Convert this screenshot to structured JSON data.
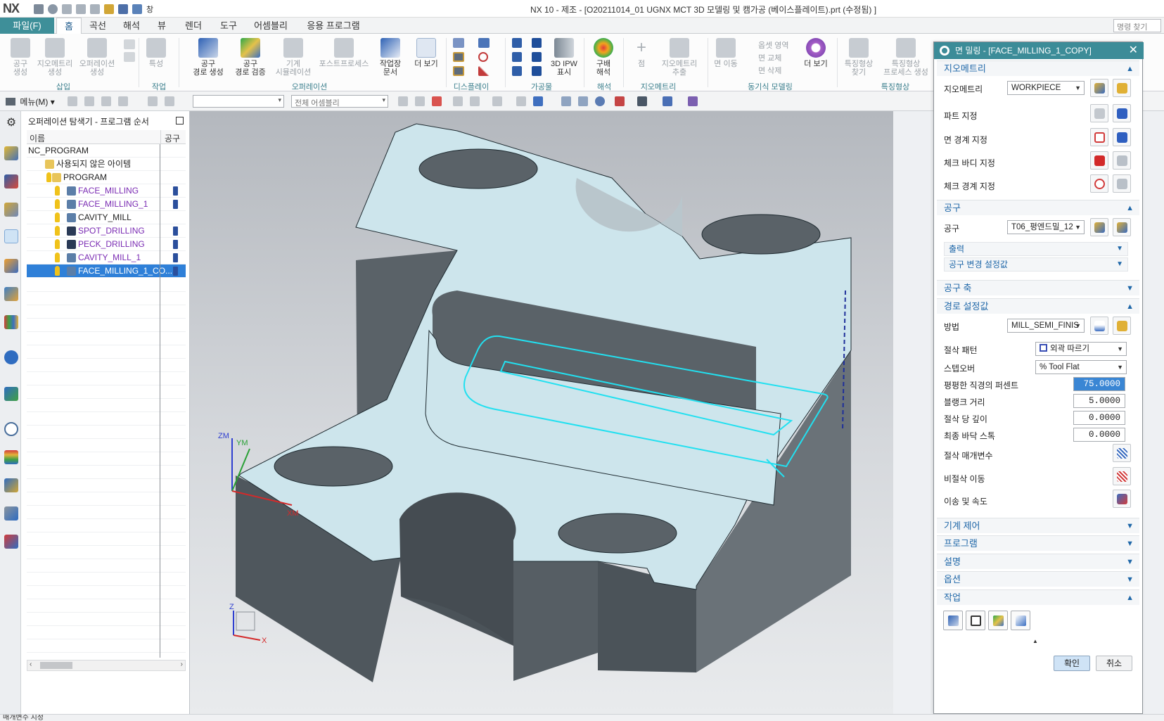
{
  "app": {
    "logo": "NX",
    "title": "NX 10 - 제조 - [O20211014_01 UGNX MCT 3D 모델링 및 캠가공 (베이스플레이트).prt (수정됨) ]",
    "qat_window_label": "창"
  },
  "menubar": {
    "file_tab": "파일(F)",
    "tabs": [
      "홈",
      "곡선",
      "해석",
      "뷰",
      "렌더",
      "도구",
      "어셈블리",
      "응용 프로그램"
    ],
    "command_search_placeholder": "명령 찾기"
  },
  "ribbon": {
    "buttons": {
      "tool_create": "공구\n생성",
      "geometry_create": "지오메트리\n생성",
      "operation_create": "오퍼레이션\n생성",
      "feature": "특성",
      "toolpath_create": "공구\n경로 생성",
      "toolpath_verify": "공구\n경로 검증",
      "machine_sim": "기계\n시뮬레이션",
      "postprocess": "포스트프로세스",
      "shop_doc": "작업장\n문서",
      "more_view": "더 보기",
      "ipw_3d": "3D IPW\n표시",
      "gradient": "구배\n해석",
      "point": "점",
      "geom_extract": "지오메트리\n추출",
      "face_move": "면 이동",
      "more_view2": "더 보기",
      "feature_find": "특징형상\n찾기",
      "feature_process": "특징형상\n프로세스 생성",
      "offset_region": "옵셋 영역",
      "face_replace": "면 교체",
      "face_delete": "면 삭제"
    },
    "groups": {
      "insert": "삽입",
      "work": "작업",
      "operation": "오퍼레이션",
      "display": "디스플레이",
      "workpiece": "가공물",
      "analysis": "해석",
      "geometry": "지오메트리",
      "sync_modeling": "동기식 모델링",
      "features": "특징형상"
    }
  },
  "toolbar2": {
    "menu": "메뉴(M)",
    "filter_combo": "",
    "assembly_combo": "전체 어셈블리"
  },
  "navigator": {
    "title": "오퍼레이션 탐색기 - 프로그램 순서",
    "col_name": "이름",
    "col_tool": "공구",
    "rows": [
      {
        "label": "NC_PROGRAM",
        "indent": 0,
        "style": "normal"
      },
      {
        "label": "사용되지 않은 아이템",
        "indent": 1,
        "style": "normal"
      },
      {
        "label": "PROGRAM",
        "indent": 1,
        "style": "normal"
      },
      {
        "label": "FACE_MILLING",
        "indent": 2,
        "style": "purple"
      },
      {
        "label": "FACE_MILLING_1",
        "indent": 2,
        "style": "purple"
      },
      {
        "label": "CAVITY_MILL",
        "indent": 2,
        "style": "normal"
      },
      {
        "label": "SPOT_DRILLING",
        "indent": 2,
        "style": "purple"
      },
      {
        "label": "PECK_DRILLING",
        "indent": 2,
        "style": "purple"
      },
      {
        "label": "CAVITY_MILL_1",
        "indent": 2,
        "style": "purple"
      },
      {
        "label": "FACE_MILLING_1_CO...",
        "indent": 2,
        "style": "selected"
      }
    ]
  },
  "viewport": {
    "axis_zm": "ZM",
    "axis_ym": "YM",
    "axis_xm": "XM",
    "triad_z": "Z",
    "triad_x": "X"
  },
  "dialog": {
    "title": "면 밀링 - [FACE_MILLING_1_COPY]",
    "sections": {
      "geometry": "지오메트리",
      "tool": "공구",
      "tool_axis": "공구 축",
      "path_settings": "경로 설정값",
      "machine_control": "기계 제어",
      "program": "프로그램",
      "description": "설명",
      "options": "옵션",
      "actions": "작업"
    },
    "geometry": {
      "label": "지오메트리",
      "value": "WORKPIECE",
      "part": "파트 지정",
      "face_boundary": "면 경계 지정",
      "check_body": "체크 바디 지정",
      "check_boundary": "체크 경계 지정"
    },
    "tool": {
      "label": "공구",
      "value": "T06_평엔드밀_12",
      "output": "출력",
      "tool_change": "공구 변경 설정값"
    },
    "path": {
      "method_label": "방법",
      "method_value": "MILL_SEMI_FINIS",
      "cut_pattern_label": "절삭 패턴",
      "cut_pattern_value": "외곽 따르기",
      "stepover_label": "스텝오버",
      "stepover_value": "% Tool Flat",
      "flat_diam_label": "평평한 직경의 퍼센트",
      "flat_diam_value": "75.0000",
      "blank_dist_label": "블랭크 거리",
      "blank_dist_value": "5.0000",
      "depth_per_cut_label": "절삭 당 깊이",
      "depth_per_cut_value": "0.0000",
      "final_floor_label": "최종 바닥 스톡",
      "final_floor_value": "0.0000",
      "cut_params": "절삭 매개변수",
      "non_cut": "비절삭 이동",
      "feeds_speeds": "이송 및 속도"
    },
    "ok": "확인",
    "cancel": "취소"
  },
  "status": {
    "text": "매개변수 지정"
  },
  "colors": {
    "accent": "#3c8c98",
    "selection": "#2f80d8",
    "purple_text": "#7a2bb3",
    "part_top": "#cde5ec",
    "part_side": "#5a6268",
    "toolpath": "#22e0f0"
  }
}
